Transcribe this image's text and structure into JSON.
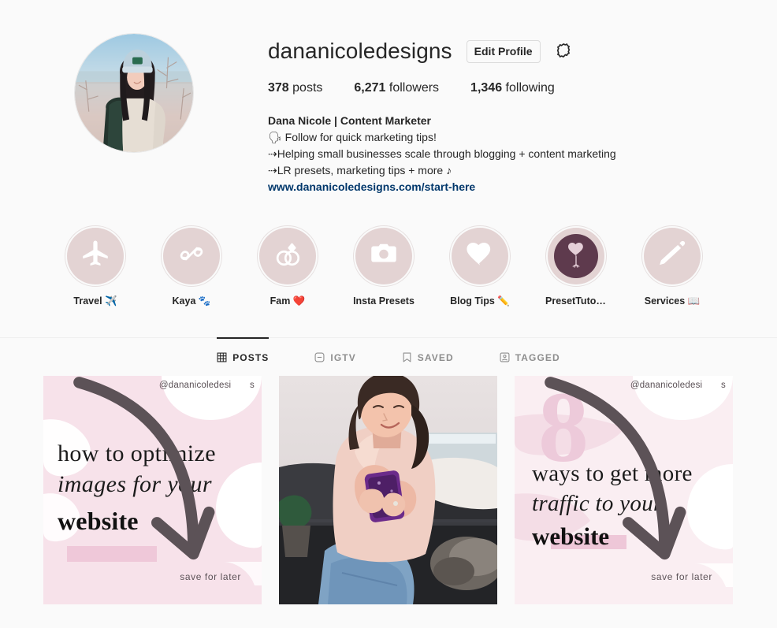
{
  "profile": {
    "username": "dananicoledesigns",
    "edit_profile_label": "Edit Profile",
    "stats": [
      {
        "value": "378",
        "label": "posts"
      },
      {
        "value": "6,271",
        "label": "followers"
      },
      {
        "value": "1,346",
        "label": "following"
      }
    ],
    "bio": {
      "display_name": "Dana Nicole | Content Marketer",
      "line1": "🗣 Follow for quick marketing tips!",
      "line2": "⇢Helping small businesses scale through blogging + content marketing",
      "line3": "⇢LR presets, marketing tips + more ♪",
      "website": "www.dananicoledesigns.com/start-here"
    }
  },
  "highlights": [
    {
      "label": "Travel ✈️",
      "icon": "airplane-icon",
      "style": "light"
    },
    {
      "label": "Kaya 🐾",
      "icon": "bone-icon",
      "style": "light"
    },
    {
      "label": "Fam ❤️",
      "icon": "rings-icon",
      "style": "light"
    },
    {
      "label": "Insta Presets",
      "icon": "camera-icon",
      "style": "light"
    },
    {
      "label": "Blog Tips ✏️",
      "icon": "heart-icon",
      "style": "light"
    },
    {
      "label": "PresetTutor...",
      "icon": "heart-balloon-icon",
      "style": "dark"
    },
    {
      "label": "Services 📖",
      "icon": "pencil-icon",
      "style": "light"
    }
  ],
  "tabs": [
    {
      "label": "POSTS",
      "icon": "grid-icon",
      "active": true
    },
    {
      "label": "IGTV",
      "icon": "igtv-icon",
      "active": false
    },
    {
      "label": "SAVED",
      "icon": "bookmark-icon",
      "active": false
    },
    {
      "label": "TAGGED",
      "icon": "tagged-icon",
      "active": false
    }
  ],
  "posts": [
    {
      "type": "text-graphic",
      "watermark": "@dananicoledesi       s",
      "line1": "how to optimize",
      "line2": "images for your",
      "line3": "website",
      "footer": "save for later"
    },
    {
      "type": "photo",
      "description": "woman in pink top on dark leather couch holding purple phone"
    },
    {
      "type": "text-graphic",
      "watermark": "@dananicoledesi       s",
      "big_number": "8",
      "line1": "ways to get more",
      "line2": "traffic to your",
      "line3": "website",
      "footer": "save for later"
    }
  ],
  "colors": {
    "background": "#fafafa",
    "text": "#262626",
    "muted": "#8e8e8e",
    "link": "#00376b",
    "highlight_pink": "#e3d3d3",
    "highlight_dark": "#5e3a4d",
    "post_pink": "#f7e4ea"
  }
}
